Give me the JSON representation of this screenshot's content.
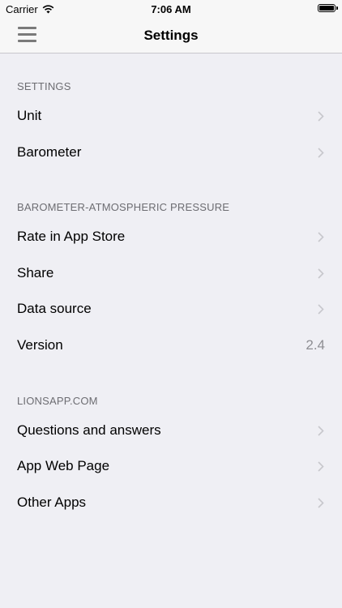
{
  "status_bar": {
    "carrier": "Carrier",
    "time": "7:06 AM",
    "wifi_icon": "wifi-icon",
    "battery_icon": "battery-icon"
  },
  "nav": {
    "title": "Settings",
    "menu_icon": "hamburger-menu-icon"
  },
  "sections": [
    {
      "header": "SETTINGS",
      "items": [
        {
          "label": "Unit",
          "accessory": "chevron"
        },
        {
          "label": "Barometer",
          "accessory": "chevron"
        }
      ]
    },
    {
      "header": "BAROMETER-ATMOSPHERIC PRESSURE",
      "items": [
        {
          "label": "Rate in App Store",
          "accessory": "chevron"
        },
        {
          "label": "Share",
          "accessory": "chevron"
        },
        {
          "label": "Data source",
          "accessory": "chevron"
        },
        {
          "label": "Version",
          "value": "2.4"
        }
      ]
    },
    {
      "header": "LIONSAPP.COM",
      "items": [
        {
          "label": "Questions and answers",
          "accessory": "chevron"
        },
        {
          "label": "App Web Page",
          "accessory": "chevron"
        },
        {
          "label": "Other Apps",
          "accessory": "chevron"
        }
      ]
    }
  ],
  "colors": {
    "background": "#efeff4",
    "bar_background": "#f7f7f7",
    "section_header": "#6d6d72",
    "chevron": "#c7c7cc",
    "value_text": "#8e8e93"
  }
}
